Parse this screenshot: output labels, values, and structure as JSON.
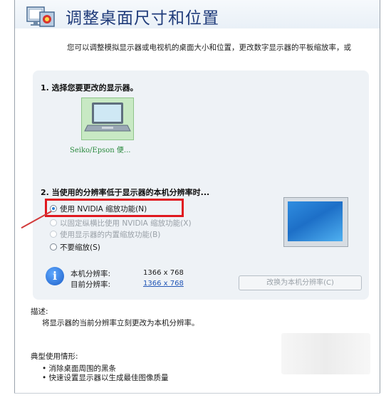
{
  "header": {
    "title": "调整桌面尺寸和位置",
    "icon": "display-settings-icon"
  },
  "intro_text": "您可以调整模拟显示器或电视机的桌面大小和位置，更改数字显示器的平板缩放率，或",
  "section1": {
    "label": "1. 选择您要更改的显示器。",
    "display_name": "Seiko/Epson 便..."
  },
  "section2": {
    "label": "2. 当使用的分辨率低于显示器的本机分辨率时...",
    "options": [
      {
        "label": "使用 NVIDIA 缩放功能(N)",
        "checked": true,
        "enabled": true
      },
      {
        "label": "以固定纵横比使用 NVIDIA 缩放功能(X)",
        "checked": false,
        "enabled": false
      },
      {
        "label": "使用显示器的内置缩放功能(B)",
        "checked": false,
        "enabled": false
      },
      {
        "label": "不要缩放(S)",
        "checked": false,
        "enabled": true
      }
    ]
  },
  "resolution": {
    "native_label": "本机分辨率:",
    "native_value": "1366 x 768",
    "current_label": "目前分辨率:",
    "current_value": "1366 x 768"
  },
  "buttons": {
    "set_native": "改换为本机分辨率(C)"
  },
  "description": {
    "title": "描述:",
    "text": "将显示器的当前分辨率立刻更改为本机分辨率。"
  },
  "typical_usage": {
    "title": "典型使用情形:",
    "items": [
      "消除桌面周围的黑条",
      "快速设置显示器以生成最佳图像质量"
    ]
  },
  "colors": {
    "highlight": "#e0181f",
    "link": "#2155b6",
    "title": "#1f3b7a"
  }
}
